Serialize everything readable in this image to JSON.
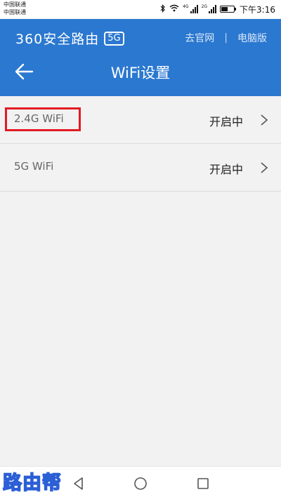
{
  "status_bar": {
    "carrier_1": "中国联通",
    "carrier_2": "中国联通",
    "sim1_tag": "4G",
    "sim2_tag": "2G",
    "time": "下午3:16",
    "icons": [
      "bluetooth-icon",
      "wifi-icon",
      "signal-icon",
      "signal-icon",
      "battery-icon"
    ]
  },
  "header": {
    "brand_text": "360安全路由",
    "brand_badge": "5G",
    "link_official": "去官网",
    "separator": "|",
    "link_pc": "电脑版",
    "title": "WiFi设置",
    "accent_color": "#2b78d0"
  },
  "list": {
    "items": [
      {
        "name": "2.4G WiFi",
        "status": "开启中",
        "highlighted": true
      },
      {
        "name": "5G WiFi",
        "status": "开启中",
        "highlighted": false
      }
    ]
  },
  "watermark": "路由帮",
  "nav": {
    "icons": [
      "back-triangle-icon",
      "home-circle-icon",
      "recents-square-icon"
    ]
  }
}
